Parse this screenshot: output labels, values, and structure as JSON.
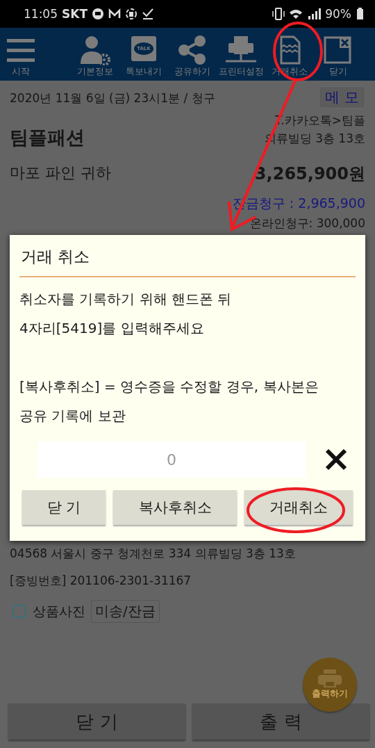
{
  "status_bar": {
    "time": "11:05",
    "carrier": "SKT",
    "battery": "90%"
  },
  "toolbar": {
    "items": [
      {
        "label": "시작"
      },
      {
        "label": "기본정보"
      },
      {
        "label": "톡보내기",
        "icon_text": "TALK"
      },
      {
        "label": "공유하기"
      },
      {
        "label": "프린터설정"
      },
      {
        "label": "거래취소"
      },
      {
        "label": "닫기"
      }
    ]
  },
  "receipt": {
    "date": "2020년 11월 6일 (금) 23시1분 / 청구",
    "memo_button": "메 모",
    "store": "팀플패션",
    "store_note": [
      "T.카카오톡>팀플",
      "의류빌딩 3층 13호"
    ],
    "customer": "마포 파인 귀하",
    "total": "3,265,900원",
    "balance": "잔금청구 : 2,965,900",
    "online": "온라인청구: 300,000",
    "address": "04568 서울시 중구 청계천로 334 의류빌딩 3층 13호",
    "proof": "[증빙번호] 201106-2301-31167",
    "photo_checkbox": {
      "label": "상품사진",
      "checked": false
    },
    "unpaid_button": "미송/잔금"
  },
  "print_fab": {
    "label": "출력하기"
  },
  "bottom_buttons": [
    "닫 기",
    "출 력"
  ],
  "dialog": {
    "title": "거래 취소",
    "paragraphs": [
      [
        "취소자를 기록하기 위해 핸드폰 뒤",
        "4자리[5419]를 입력해주세요"
      ],
      [
        "[복사후취소] = 영수증을 수정할 경우, 복사본은",
        "공유 기록에 보관"
      ]
    ],
    "input": {
      "placeholder": "0"
    },
    "buttons": [
      "닫 기",
      "복사후취소",
      "거래취소"
    ]
  }
}
